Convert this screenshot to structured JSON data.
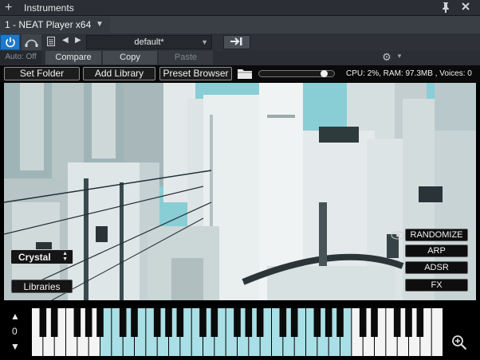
{
  "window": {
    "title": "Instruments"
  },
  "plugin_selector": {
    "name": "1 - NEAT Player x64"
  },
  "toolbar": {
    "preset": "default*"
  },
  "compare_row": {
    "auto_off": "Auto: Off",
    "compare": "Compare",
    "copy": "Copy",
    "paste": "Paste"
  },
  "player": {
    "set_folder": "Set Folder",
    "add_library": "Add Library",
    "preset_browser": "Preset Browser",
    "volume": 0.9,
    "stats": "CPU: 2%, RAM: 97.3MB , Voices: 0"
  },
  "sound": {
    "selected": "Crystal",
    "libraries": "Libraries"
  },
  "side_buttons": {
    "randomize": "RANDOMIZE",
    "arp": "ARP",
    "adsr": "ADSR",
    "fx": "FX"
  },
  "keyboard": {
    "octave": "0"
  },
  "icons": [
    "plus-icon",
    "pin-icon",
    "close-icon",
    "power-icon",
    "monitor-icon",
    "page-icon",
    "prev-icon",
    "next-icon",
    "load-icon",
    "gear-icon",
    "folder-icon",
    "eye-icon",
    "zoom-icon"
  ]
}
